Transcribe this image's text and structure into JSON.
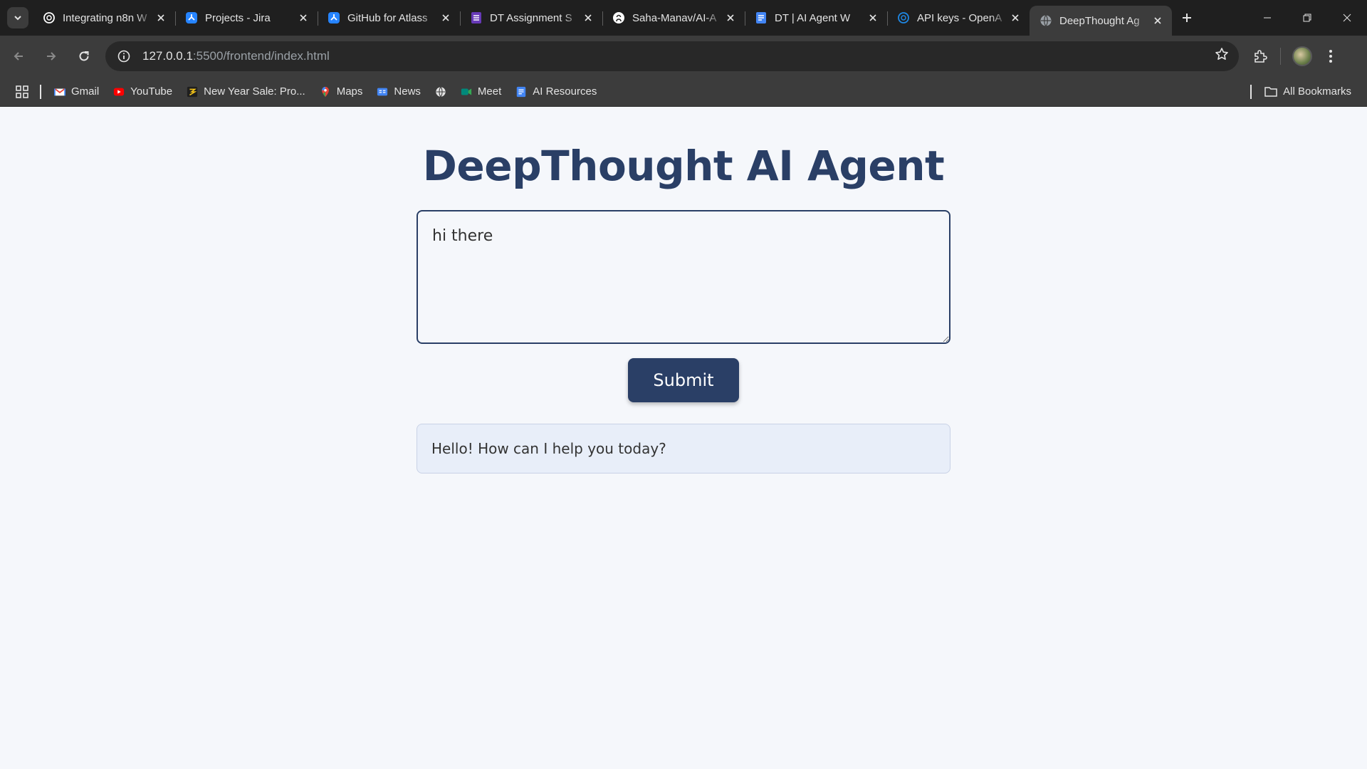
{
  "tabs": [
    {
      "title": "Integrating n8n W",
      "icon": "openai-icon",
      "color": "#ffffff"
    },
    {
      "title": "Projects - Jira",
      "icon": "jira-icon",
      "color": "#2684ff"
    },
    {
      "title": "GitHub for Atlass",
      "icon": "jira-icon",
      "color": "#2684ff"
    },
    {
      "title": "DT Assignment S",
      "icon": "forms-icon",
      "color": "#673ab7"
    },
    {
      "title": "Saha-Manav/AI-A",
      "icon": "github-icon",
      "color": "#ffffff"
    },
    {
      "title": "DT | AI Agent W",
      "icon": "docs-icon",
      "color": "#4285f4"
    },
    {
      "title": "API keys - OpenA",
      "icon": "openai-icon",
      "color": "#1e88e5"
    },
    {
      "title": "DeepThought Ag",
      "icon": "globe-icon",
      "color": "#9aa0a6",
      "active": true
    }
  ],
  "address_bar": {
    "host": "127.0.0.1",
    "path": ":5500/frontend/index.html"
  },
  "bookmarks": [
    {
      "label": "Gmail",
      "icon": "gmail-icon",
      "color": "#ea4335"
    },
    {
      "label": "YouTube",
      "icon": "youtube-icon",
      "color": "#ff0000"
    },
    {
      "label": "New Year Sale: Pro...",
      "icon": "sale-icon",
      "color": "#f5c518"
    },
    {
      "label": "Maps",
      "icon": "maps-icon",
      "color": "#34a853"
    },
    {
      "label": "News",
      "icon": "news-icon",
      "color": "#4285f4"
    },
    {
      "label": "",
      "icon": "globe-icon",
      "color": "#e3e3e3"
    },
    {
      "label": "Meet",
      "icon": "meet-icon",
      "color": "#00897b"
    },
    {
      "label": "AI Resources",
      "icon": "docs-icon",
      "color": "#4285f4"
    }
  ],
  "all_bookmarks_label": "All Bookmarks",
  "app": {
    "title": "DeepThought AI Agent",
    "input_value": "hi there",
    "submit_label": "Submit",
    "response": "Hello! How can I help you today?"
  },
  "colors": {
    "accent": "#2a3f66",
    "response_bg": "#e8eef9"
  }
}
